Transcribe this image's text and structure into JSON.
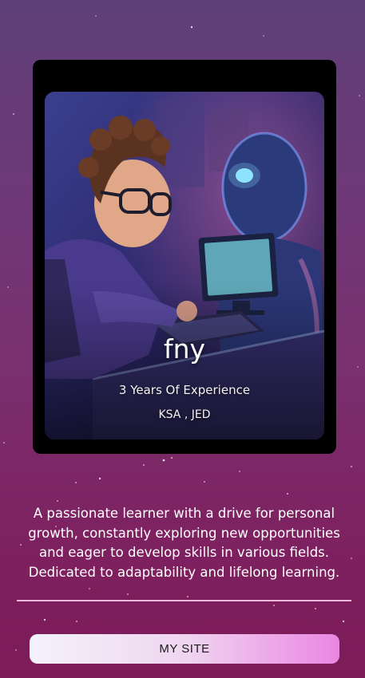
{
  "profile": {
    "name": "fny",
    "experience": "3 Years Of Experience",
    "location": "KSA , JED"
  },
  "bio": "A passionate learner with a drive for personal growth, constantly exploring new opportunities and eager to develop skills in various fields. Dedicated to adaptability and lifelong learning.",
  "actions": {
    "site_label": "MY SITE"
  },
  "colors": {
    "background_top": "#5e3f78",
    "background_bottom": "#7c1b58",
    "card": "#000000",
    "divider": "#f4b9dc",
    "button_start": "#f4f2fb",
    "button_end": "#ea86e2"
  },
  "illustration": "boy-with-glasses-and-robot-at-computer"
}
